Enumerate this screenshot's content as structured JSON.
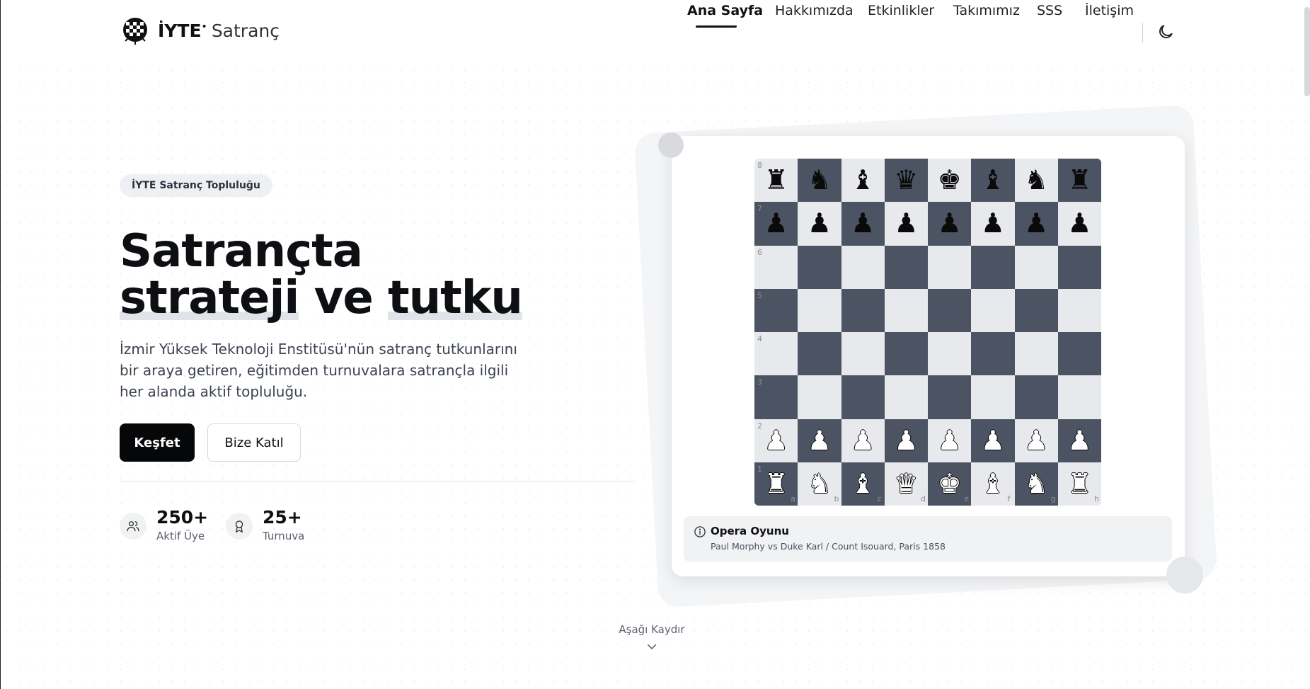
{
  "brand": {
    "name": "İYTE",
    "dot": "•",
    "suffix": "Satranç"
  },
  "nav": {
    "items": [
      {
        "label": "Ana Sayfa",
        "active": true
      },
      {
        "label": "Hakkımızda",
        "active": false
      },
      {
        "label": "Etkinlikler",
        "active": false
      },
      {
        "label": "Takımımız",
        "active": false
      },
      {
        "label": "SSS",
        "active": false
      },
      {
        "label": "İletişim",
        "active": false
      }
    ],
    "theme_icon": "moon-icon"
  },
  "hero": {
    "badge": "İYTE Satranç Topluluğu",
    "title_line1": "Satrançta",
    "title_word1": "strateji",
    "title_word2": "ve",
    "title_word3": "tutku",
    "description": "İzmir Yüksek Teknoloji Enstitüsü'nün satranç tutkunlarını bir araya getiren, eğitimden turnuvalara satrançla ilgili her alanda aktif topluluğu.",
    "primary_button": "Keşfet",
    "secondary_button": "Bize Katıl",
    "stats": [
      {
        "value": "250+",
        "label": "Aktif Üye",
        "icon": "users-icon"
      },
      {
        "value": "25+",
        "label": "Turnuva",
        "icon": "award-icon"
      }
    ]
  },
  "board": {
    "ranks": [
      "8",
      "7",
      "6",
      "5",
      "4",
      "3",
      "2",
      "1"
    ],
    "files": [
      "a",
      "b",
      "c",
      "d",
      "e",
      "f",
      "g",
      "h"
    ],
    "position": [
      [
        "r",
        "n",
        "b",
        "q",
        "k",
        "b",
        "n",
        "r"
      ],
      [
        "p",
        "p",
        "p",
        "p",
        "p",
        "p",
        "p",
        "p"
      ],
      [
        "",
        "",
        "",
        "",
        "",
        "",
        "",
        ""
      ],
      [
        "",
        "",
        "",
        "",
        "",
        "",
        "",
        ""
      ],
      [
        "",
        "",
        "",
        "",
        "",
        "",
        "",
        ""
      ],
      [
        "",
        "",
        "",
        "",
        "",
        "",
        "",
        ""
      ],
      [
        "P",
        "P",
        "P",
        "P",
        "P",
        "P",
        "P",
        "P"
      ],
      [
        "R",
        "N",
        "B",
        "Q",
        "K",
        "B",
        "N",
        "R"
      ]
    ],
    "game_title": "Opera Oyunu",
    "game_subtitle": "Paul Morphy vs Duke Karl / Count Isouard, Paris 1858",
    "info_icon": "info-icon"
  },
  "scroll_hint": "Aşağı Kaydır",
  "colors": {
    "dark_square": "#4c5463",
    "light_square": "#e8e9ec",
    "primary": "#060708"
  }
}
